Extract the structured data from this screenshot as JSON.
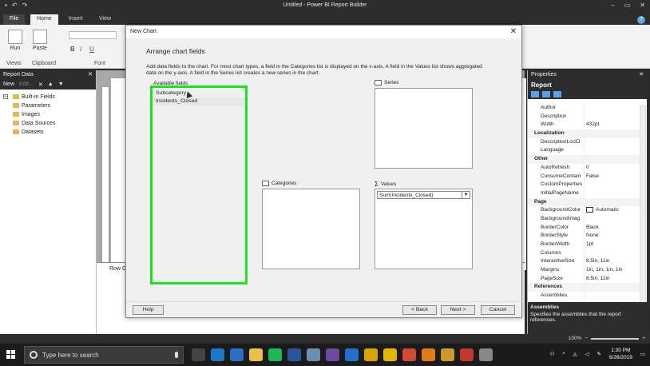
{
  "titlebar": {
    "title": "Untitled - Power BI Report Builder",
    "qa_icons": [
      "save-icon",
      "undo-icon",
      "redo-icon"
    ],
    "win_controls": [
      "−",
      "▭",
      "✕"
    ]
  },
  "ribbon": {
    "tabs": [
      {
        "label": "File"
      },
      {
        "label": "Home"
      },
      {
        "label": "Insert"
      },
      {
        "label": "View"
      }
    ],
    "run_label": "Run",
    "paste_label": "Paste",
    "groups": {
      "views": "Views",
      "clipboard": "Clipboard",
      "font": "Font"
    }
  },
  "report_data": {
    "title": "Report Data",
    "toolbar": {
      "new_label": "New",
      "edit_label": "Edit..."
    },
    "items": [
      {
        "label": "Built-in Fields",
        "expandable": true
      },
      {
        "label": "Parameters",
        "expandable": false
      },
      {
        "label": "Images",
        "expandable": false
      },
      {
        "label": "Data Sources",
        "expandable": false
      },
      {
        "label": "Datasets",
        "expandable": false
      }
    ]
  },
  "canvas": {
    "row_groups_label": "Row G"
  },
  "dialog": {
    "title": "New Chart",
    "heading": "Arrange chart fields",
    "intro": "Add data fields to the chart. For most chart types, a field in the Categories list is displayed on the x-axis. A field in the Values list shows aggregated data on the y-axis. A field in the Series list creates a new series in the chart.",
    "available_label": "Available fields",
    "available_fields": [
      "Subcategory",
      "Incidents_Closed"
    ],
    "series_label": "Series",
    "categories_label": "Categories",
    "values_label": "Values",
    "values_items": [
      "Sum(Incidents_Closed)"
    ],
    "buttons": {
      "help": "Help",
      "back": "< Back",
      "next": "Next >",
      "cancel": "Cancel"
    },
    "highlight_color": "#19e619"
  },
  "properties": {
    "title": "Properties",
    "object": "Report",
    "rows": [
      {
        "k": "Author",
        "v": ""
      },
      {
        "k": "Description",
        "v": ""
      },
      {
        "k": "Width",
        "v": "432pt"
      },
      {
        "k": "Localization",
        "v": "",
        "cat": true
      },
      {
        "k": "DescriptionLocID",
        "v": ""
      },
      {
        "k": "Language",
        "v": ""
      },
      {
        "k": "Other",
        "v": "",
        "cat": true
      },
      {
        "k": "AutoRefresh",
        "v": "0"
      },
      {
        "k": "ConsumeContain",
        "v": "False"
      },
      {
        "k": "CustomProperties",
        "v": ""
      },
      {
        "k": "InitialPageName",
        "v": ""
      },
      {
        "k": "Page",
        "v": "",
        "cat": true
      },
      {
        "k": "BackgroundColor",
        "v": "Automatic"
      },
      {
        "k": "BackgroundImag",
        "v": ""
      },
      {
        "k": "BorderColor",
        "v": "Black"
      },
      {
        "k": "BorderStyle",
        "v": "None"
      },
      {
        "k": "BorderWidth",
        "v": "1pt"
      },
      {
        "k": "Columns",
        "v": ""
      },
      {
        "k": "InteractiveSize",
        "v": "8.5in, 11in"
      },
      {
        "k": "Margins",
        "v": "1in, 1in, 1in, 1in"
      },
      {
        "k": "PageSize",
        "v": "8.5in, 11in"
      },
      {
        "k": "References",
        "v": "",
        "cat": true
      },
      {
        "k": "Assemblies",
        "v": ""
      }
    ],
    "desc_title": "Assemblies",
    "desc_text": "Specifies the assemblies that the report references."
  },
  "statusbar": {
    "zoom": "100%"
  },
  "taskbar": {
    "search_placeholder": "Type here to search",
    "time": "1:30 PM",
    "date": "6/26/2019",
    "apps": [
      {
        "name": "task-view-icon",
        "color": "#444"
      },
      {
        "name": "edge-icon",
        "color": "#1e78c8"
      },
      {
        "name": "mail-icon",
        "color": "#2d6fc4"
      },
      {
        "name": "file-explorer-icon",
        "color": "#e8c04a"
      },
      {
        "name": "spotify-icon",
        "color": "#1db954"
      },
      {
        "name": "word-icon",
        "color": "#2b579a"
      },
      {
        "name": "chrome-alt-icon",
        "color": "#6a8fb0"
      },
      {
        "name": "photos-icon",
        "color": "#6b4aa0"
      },
      {
        "name": "app-blue-icon",
        "color": "#2070d0"
      },
      {
        "name": "app-yellow-icon",
        "color": "#d9a400"
      },
      {
        "name": "powerbi-builder-icon",
        "color": "#e3b600"
      },
      {
        "name": "chrome-icon",
        "color": "#d14836"
      },
      {
        "name": "app-orange-icon",
        "color": "#e07a1b"
      },
      {
        "name": "app-gold-icon",
        "color": "#c89b2a"
      },
      {
        "name": "app-red-icon",
        "color": "#c0392b"
      },
      {
        "name": "app-gray-icon",
        "color": "#888"
      }
    ]
  }
}
